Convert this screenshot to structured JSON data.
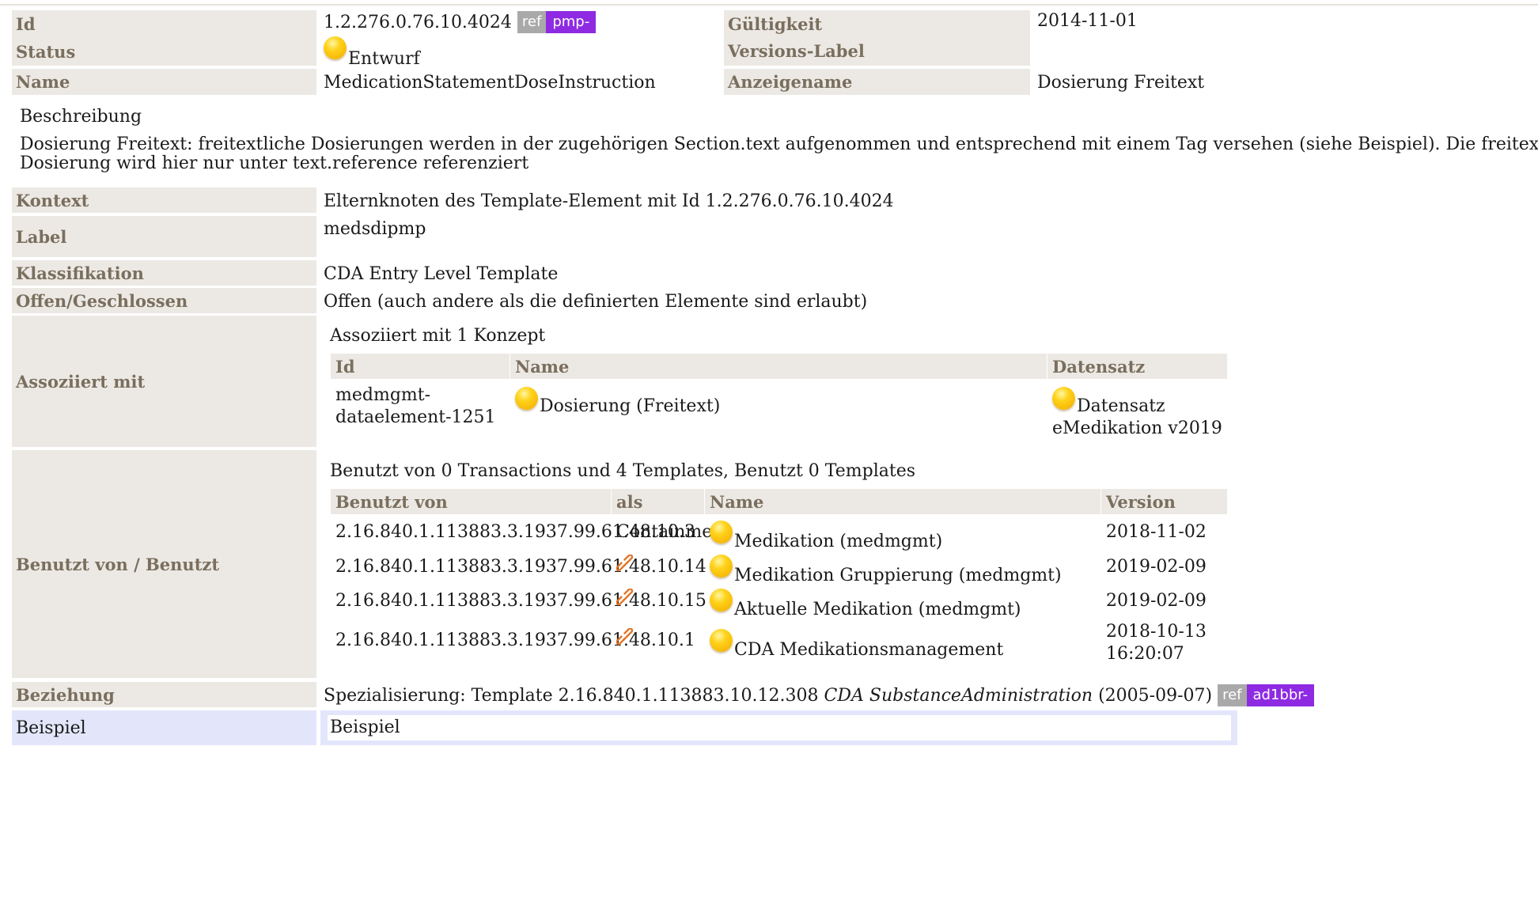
{
  "header": {
    "id_label": "Id",
    "id_value": "1.2.276.0.76.10.4024",
    "id_ref": "ref",
    "id_ref_tag": "pmp-",
    "valid_label": "Gültigkeit",
    "valid_value": "2014-11-01",
    "status_label": "Status",
    "status_value": "Entwurf",
    "version_label": "Versions-Label",
    "name_label": "Name",
    "name_value": "MedicationStatementDoseInstruction",
    "display_label": "Anzeigename",
    "display_value": "Dosierung Freitext"
  },
  "description": {
    "title": "Beschreibung",
    "line1": "Dosierung Freitext: freitextliche Dosierungen werden in der zugehörigen Section.text aufgenommen und entsprechend mit einem Tag versehen (siehe Beispiel). Die freitextliche",
    "line2": "Dosierung wird hier nur unter text.reference referenziert"
  },
  "rows": {
    "context_label": "Kontext",
    "context_value": "Elternknoten des Template-Element mit Id 1.2.276.0.76.10.4024",
    "label_label": "Label",
    "label_value": "medsdipmp",
    "class_label": "Klassifikation",
    "class_value": "CDA Entry Level Template",
    "open_label": "Offen/Geschlossen",
    "open_value": "Offen (auch andere als die definierten Elemente sind erlaubt)"
  },
  "associated": {
    "label": "Assoziiert mit",
    "intro": "Assoziiert mit 1 Konzept",
    "col_id": "Id",
    "col_name": "Name",
    "col_dataset": "Datensatz",
    "row": {
      "id_line1": "medmgmt-",
      "id_line2": "dataelement-1251",
      "name": "Dosierung (Freitext)",
      "dataset_line1": "Datensatz",
      "dataset_line2": "eMedikation v2019"
    }
  },
  "usage": {
    "label": "Benutzt von / Benutzt",
    "intro": "Benutzt von 0 Transactions und 4 Templates, Benutzt 0 Templates",
    "col_used_by": "Benutzt von",
    "col_as": "als",
    "col_name": "Name",
    "col_version": "Version",
    "rows": [
      {
        "oid": "2.16.840.1.113883.3.1937.99.61.48.10.3",
        "as": "Containment",
        "name": "Medikation (medmgmt)",
        "version": "2018-11-02"
      },
      {
        "oid": "2.16.840.1.113883.3.1937.99.61.48.10.14",
        "as": "link-icon",
        "name": "Medikation Gruppierung (medmgmt)",
        "version": "2019-02-09"
      },
      {
        "oid": "2.16.840.1.113883.3.1937.99.61.48.10.15",
        "as": "link-icon",
        "name": "Aktuelle Medikation (medmgmt)",
        "version": "2019-02-09"
      },
      {
        "oid": "2.16.840.1.113883.3.1937.99.61.48.10.1",
        "as": "link-icon",
        "name": "CDA Medikationsmanagement",
        "version_line1": "2018-10-13",
        "version_line2": "16:20:07"
      }
    ]
  },
  "relation": {
    "label": "Beziehung",
    "prefix": "Spezialisierung: Template 2.16.840.1.113883.10.12.308",
    "template_name": "CDA SubstanceAdministration",
    "date": "(2005-09-07)",
    "ref": "ref",
    "ref_tag": "ad1bbr-"
  },
  "example": {
    "label": "Beispiel",
    "value": "Beispiel"
  },
  "colors": {
    "label_bg": "#ece9e4",
    "label_text": "#7a6e5e",
    "ref_badge": "#a9a9a9",
    "id_badge": "#8e2be2",
    "example_bg": "#e3e6fb",
    "status_dot": "#ffd21a"
  }
}
